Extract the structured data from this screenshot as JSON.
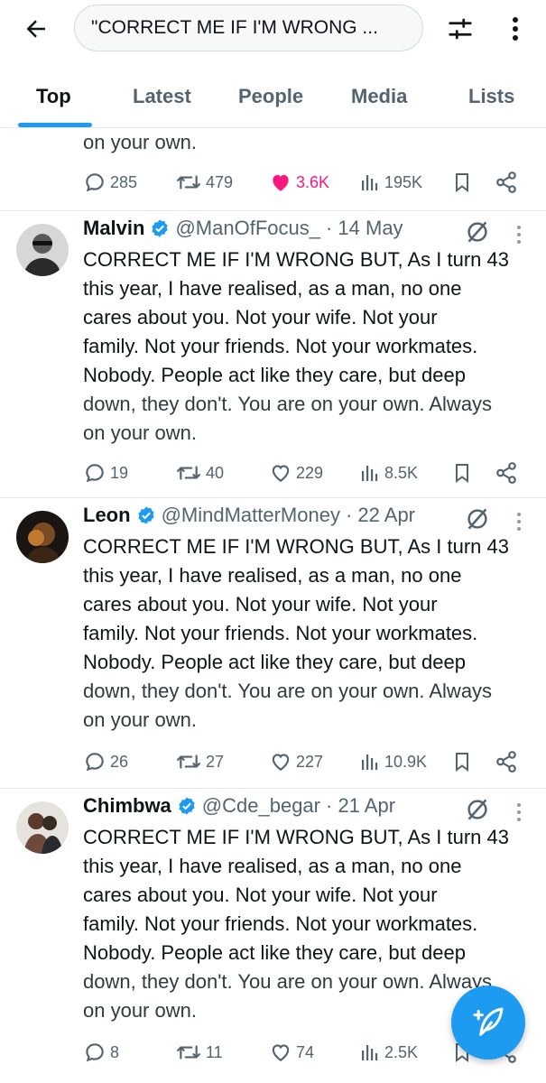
{
  "search": {
    "query": "\"CORRECT ME IF I'M WRONG ..."
  },
  "tabs": [
    {
      "label": "Top",
      "active": true
    },
    {
      "label": "Latest",
      "active": false
    },
    {
      "label": "People",
      "active": false
    },
    {
      "label": "Media",
      "active": false
    },
    {
      "label": "Lists",
      "active": false
    }
  ],
  "fragment": {
    "text_tail": "on your own.",
    "replies": "285",
    "reposts": "479",
    "likes": "3.6K",
    "views": "195K",
    "liked": true
  },
  "tweet_lines": [
    "CORRECT ME IF I'M WRONG BUT, As I turn 43",
    "this year, I have realised, as a man, no one",
    "cares about you. Not your wife. Not your",
    "family. Not your friends. Not your workmates.",
    "Nobody. People act like they care, but deep",
    "down, they don't. You are on your own. Always",
    "on your own."
  ],
  "tweets": [
    {
      "name": "Malvin",
      "handle": "@ManOfFocus_",
      "date": "· 14 May",
      "replies": "19",
      "reposts": "40",
      "likes": "229",
      "views": "8.5K"
    },
    {
      "name": "Leon",
      "handle": "@MindMatterMoney",
      "date": "· 22 Apr",
      "replies": "26",
      "reposts": "27",
      "likes": "227",
      "views": "10.9K"
    },
    {
      "name": "Chimbwa",
      "handle": "@Cde_begar",
      "date": "· 21 Apr",
      "replies": "8",
      "reposts": "11",
      "likes": "74",
      "views": "2.5K"
    }
  ],
  "colors": {
    "accent": "#1d9bf0",
    "like": "#f91880",
    "secondary": "#536471"
  },
  "icons": [
    "back-arrow-icon",
    "filter-icon",
    "more-vertical-icon",
    "reply-icon",
    "repost-icon",
    "like-icon",
    "views-icon",
    "bookmark-icon",
    "share-icon",
    "verified-icon",
    "grok-icon",
    "compose-icon"
  ]
}
